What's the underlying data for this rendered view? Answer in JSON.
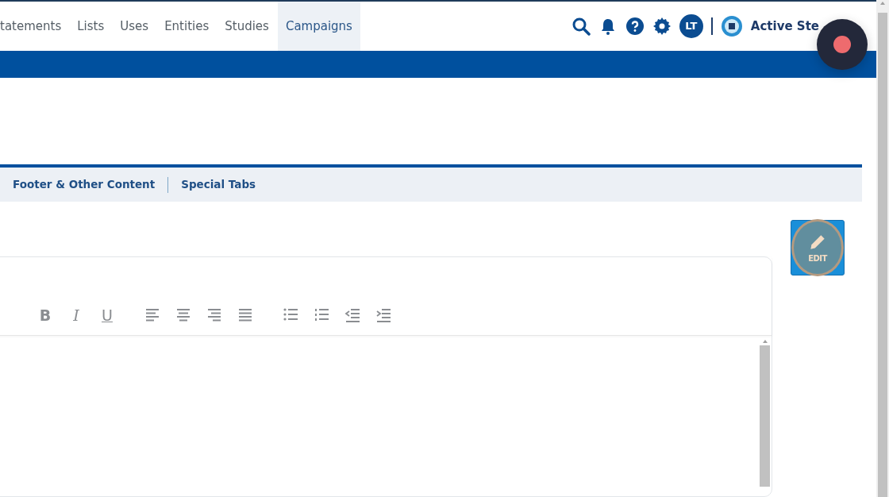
{
  "nav": {
    "items": [
      {
        "label": "tatements",
        "selected": false
      },
      {
        "label": "Lists",
        "selected": false
      },
      {
        "label": "Uses",
        "selected": false
      },
      {
        "label": "Entities",
        "selected": false
      },
      {
        "label": "Studies",
        "selected": false
      },
      {
        "label": "Campaigns",
        "selected": true
      }
    ],
    "user_initials": "LT",
    "brand": "Active Ste"
  },
  "tabs": [
    {
      "label": "Footer & Other Content"
    },
    {
      "label": "Special Tabs"
    }
  ],
  "edit_button": {
    "label": "EDIT"
  },
  "toolbar": [
    {
      "kind": "bold",
      "label": "B"
    },
    {
      "kind": "italic",
      "label": "I"
    },
    {
      "kind": "underline",
      "label": "U"
    },
    {
      "kind": "left"
    },
    {
      "kind": "center"
    },
    {
      "kind": "right"
    },
    {
      "kind": "justify"
    },
    {
      "kind": "bullets"
    },
    {
      "kind": "numbers"
    },
    {
      "kind": "outdent"
    },
    {
      "kind": "indent"
    }
  ]
}
